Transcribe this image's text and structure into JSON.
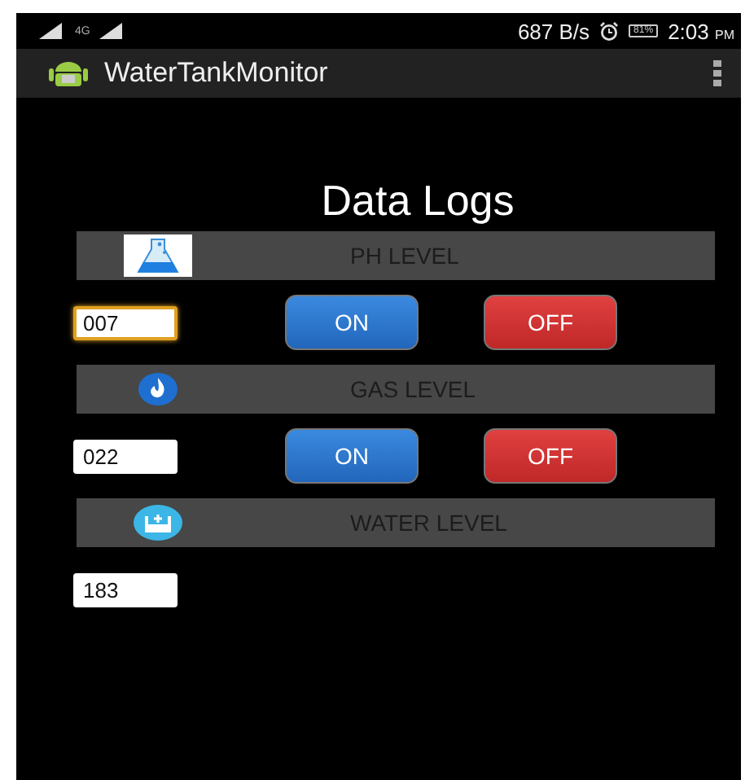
{
  "status_bar": {
    "network": "4G",
    "speed": "687 B/s",
    "battery": "81%",
    "time": "2:03",
    "meridiem": "PM"
  },
  "app_bar": {
    "title": "WaterTankMonitor"
  },
  "heading": "Data Logs",
  "sections": [
    {
      "label": "PH LEVEL",
      "kind": "flask",
      "value": "007",
      "focused": true,
      "buttons": [
        {
          "label": "ON",
          "kind": "on"
        },
        {
          "label": "OFF",
          "kind": "off"
        }
      ]
    },
    {
      "label": "GAS LEVEL",
      "kind": "flame",
      "value": "022",
      "focused": false,
      "buttons": [
        {
          "label": "ON",
          "kind": "on"
        },
        {
          "label": "OFF",
          "kind": "off"
        }
      ]
    },
    {
      "label": "WATER LEVEL",
      "kind": "tank",
      "value": "183",
      "focused": false
    }
  ]
}
